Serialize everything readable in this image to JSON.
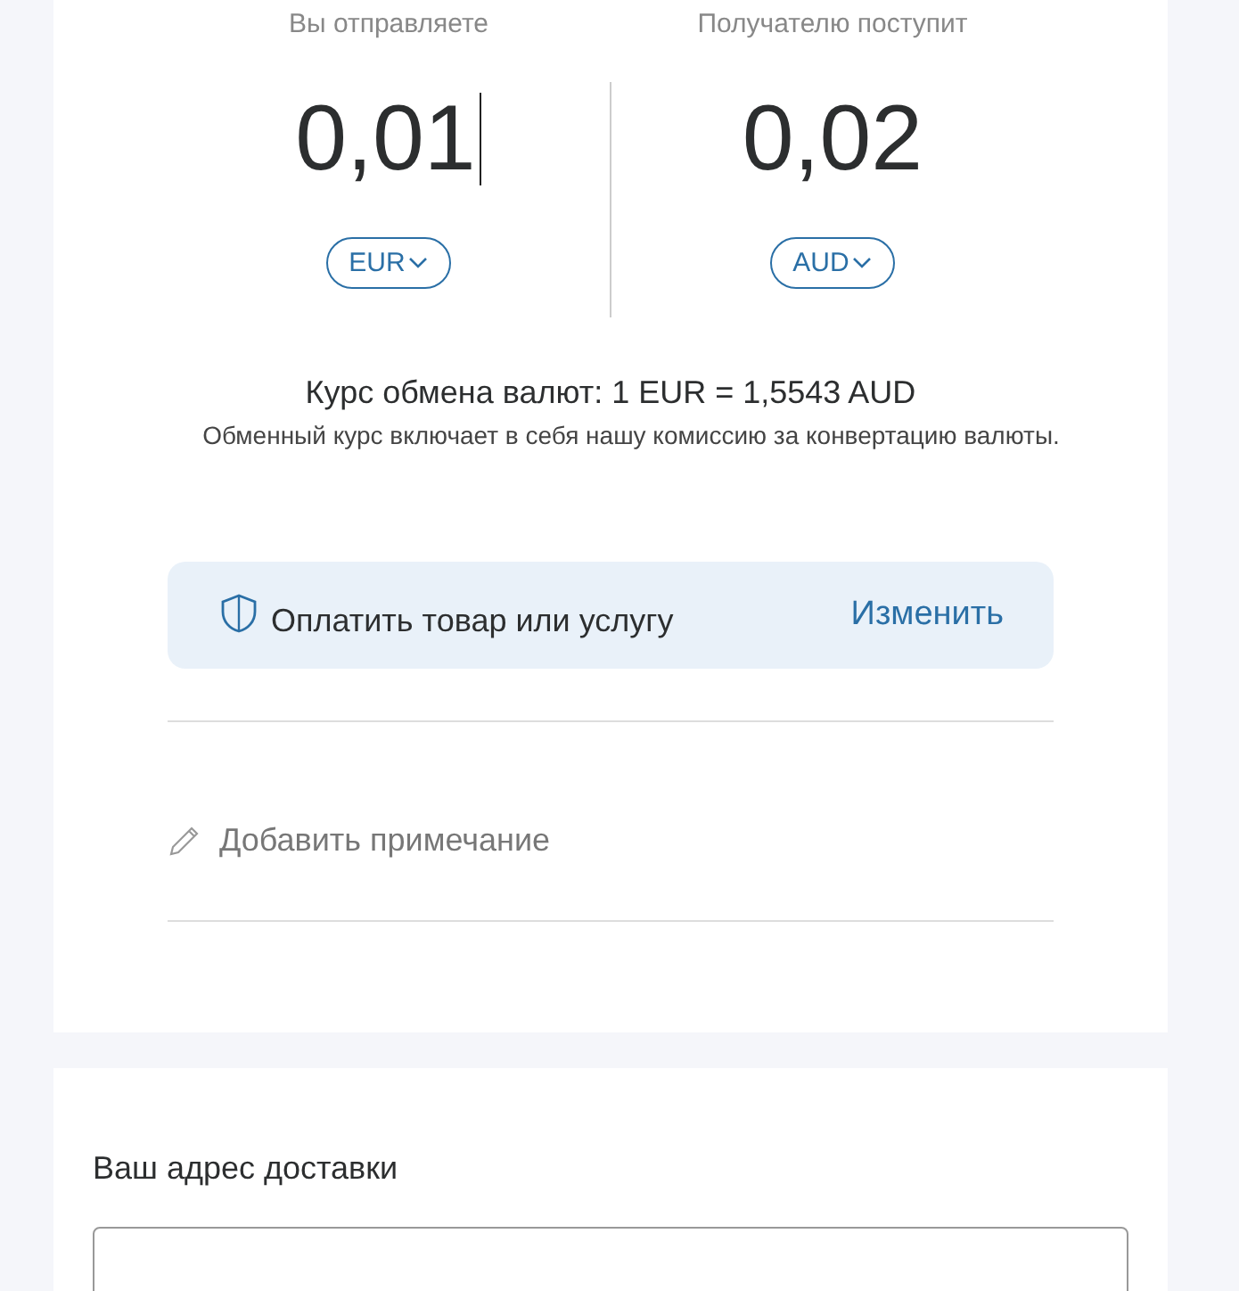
{
  "send": {
    "label": "Вы отправляете",
    "amount": "0,01",
    "focused": true,
    "currency": "EUR"
  },
  "receive": {
    "label": "Получателю поступит",
    "amount": "0,02",
    "currency": "AUD"
  },
  "rate": "Курс обмена валют: 1 EUR = 1,5543 AUD",
  "rate_note": "Обменный курс включает в себя нашу комиссию за конвертацию валюты.",
  "payment_type": {
    "label": "Оплатить товар или услугу",
    "action": "Изменить"
  },
  "note": {
    "placeholder": "Добавить примечание"
  },
  "shipping": {
    "title": "Ваш адрес доставки"
  }
}
